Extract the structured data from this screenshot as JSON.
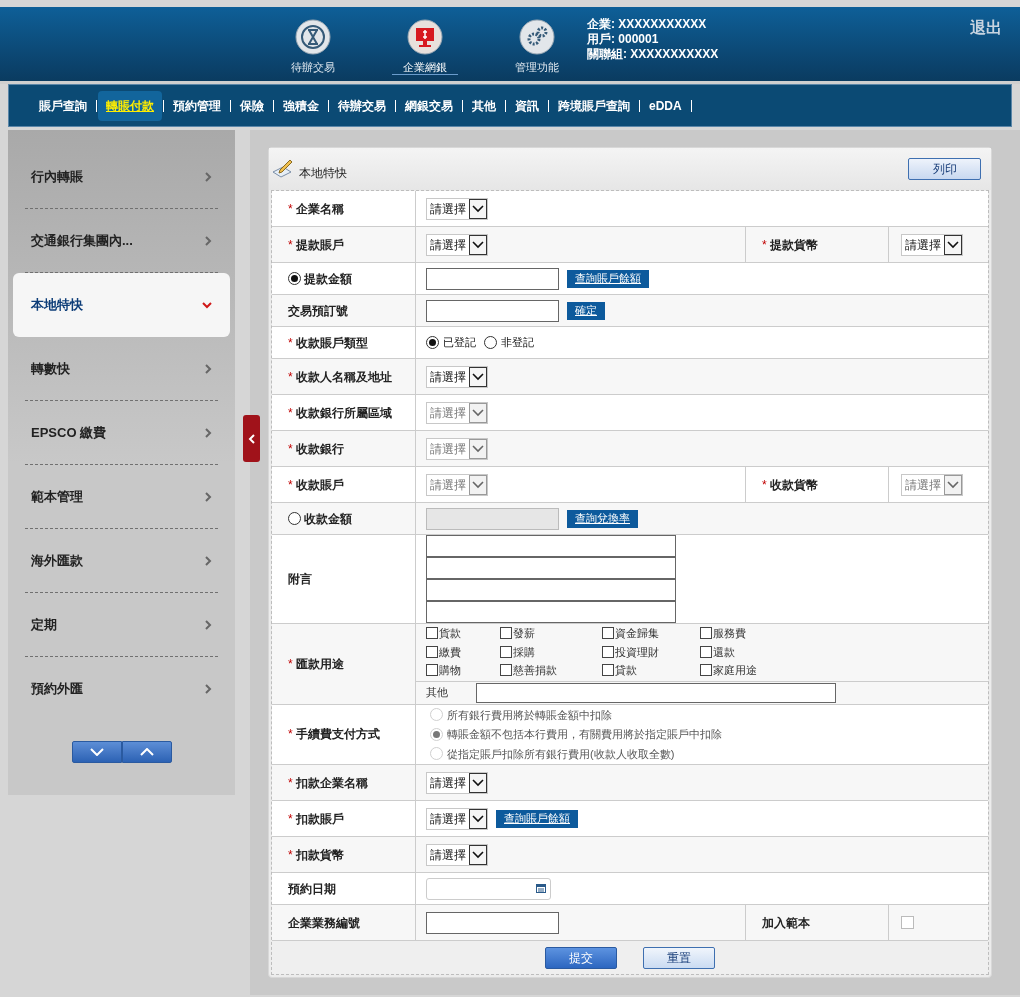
{
  "header": {
    "apps": [
      {
        "label": "待辦交易",
        "selected": false,
        "kind": "hourglass"
      },
      {
        "label": "企業網銀",
        "selected": true,
        "kind": "monitor"
      },
      {
        "label": "管理功能",
        "selected": false,
        "kind": "gears"
      }
    ],
    "user_info": [
      "企業: XXXXXXXXXXX",
      "用戶: 000001",
      "關聯組: XXXXXXXXXXX"
    ],
    "logout": "退出"
  },
  "nav": [
    {
      "label": "賬戶查詢",
      "selected": false
    },
    {
      "label": "轉賬付款",
      "selected": true
    },
    {
      "label": "預約管理",
      "selected": false
    },
    {
      "label": "保險",
      "selected": false
    },
    {
      "label": "強積金",
      "selected": false
    },
    {
      "label": "待辦交易",
      "selected": false
    },
    {
      "label": "網銀交易",
      "selected": false
    },
    {
      "label": "其他",
      "selected": false
    },
    {
      "label": "資訊",
      "selected": false
    },
    {
      "label": "跨境賬戶查詢",
      "selected": false
    },
    {
      "label": "eDDA",
      "selected": false
    }
  ],
  "sidebar": {
    "items": [
      {
        "label": "行內轉賬",
        "selected": false
      },
      {
        "label": "交通銀行集團內...",
        "selected": false
      },
      {
        "label": "本地特快",
        "selected": true
      },
      {
        "label": "轉數快",
        "selected": false
      },
      {
        "label": "EPSCO 繳費",
        "selected": false
      },
      {
        "label": "範本管理",
        "selected": false
      },
      {
        "label": "海外匯款",
        "selected": false
      },
      {
        "label": "定期",
        "selected": false
      },
      {
        "label": "預約外匯",
        "selected": false
      }
    ]
  },
  "panel": {
    "title": "本地特快",
    "print_button": "列印",
    "rows": [
      {
        "kind": "inline",
        "mark": "*",
        "label": "企業名稱",
        "cells": [
          {
            "kind": "select",
            "text": "請選擇",
            "disabled": false
          }
        ]
      },
      {
        "kind": "inline",
        "mark": "*",
        "label": "提款賬戶",
        "cells": [
          {
            "kind": "select",
            "text": "請選擇",
            "disabled": false
          }
        ],
        "side": {
          "mark": "*",
          "label": "提款貨幣",
          "cells": [
            {
              "kind": "select",
              "text": "請選擇",
              "disabled": false
            }
          ]
        }
      },
      {
        "kind": "inline",
        "radio_selected": true,
        "label": "提款金額",
        "cells": [
          {
            "kind": "input",
            "disabled": false
          },
          {
            "kind": "action",
            "label": "查詢賬戶餘額"
          }
        ]
      },
      {
        "kind": "inline",
        "label": "交易預訂號",
        "cells": [
          {
            "kind": "input",
            "disabled": false
          },
          {
            "kind": "action",
            "label": "確定"
          }
        ]
      },
      {
        "kind": "inline",
        "mark": "*",
        "label": "收款賬戶類型",
        "cells": [
          {
            "kind": "radio",
            "label": "已登記",
            "selected": true,
            "disabled": false
          },
          {
            "kind": "radio",
            "label": "非登記",
            "selected": false,
            "disabled": false
          }
        ]
      },
      {
        "kind": "inline",
        "mark": "*",
        "label": "收款人名稱及地址",
        "cells": [
          {
            "kind": "select",
            "text": "請選擇",
            "disabled": false
          }
        ]
      },
      {
        "kind": "inline",
        "mark": "*",
        "label": "收款銀行所屬區域",
        "cells": [
          {
            "kind": "select",
            "text": "請選擇",
            "disabled": true
          }
        ]
      },
      {
        "kind": "inline",
        "mark": "*",
        "label": "收款銀行",
        "cells": [
          {
            "kind": "select",
            "text": "請選擇",
            "disabled": true
          }
        ]
      },
      {
        "kind": "inline",
        "mark": "*",
        "label": "收款賬戶",
        "cells": [
          {
            "kind": "select",
            "text": "請選擇",
            "disabled": true
          }
        ],
        "side": {
          "mark": "*",
          "label": "收款貨幣",
          "cells": [
            {
              "kind": "select",
              "text": "請選擇",
              "disabled": true
            }
          ]
        }
      },
      {
        "kind": "inline",
        "radio_selected": false,
        "label": "收款金額",
        "cells": [
          {
            "kind": "input",
            "disabled": true
          },
          {
            "kind": "action",
            "label": "查詢兌換率"
          }
        ]
      },
      {
        "kind": "stacked",
        "label": "附言",
        "cells": [
          {
            "kind": "input",
            "disabled": false
          },
          {
            "kind": "input",
            "disabled": false
          },
          {
            "kind": "input",
            "disabled": false
          },
          {
            "kind": "input",
            "disabled": false
          }
        ]
      },
      {
        "kind": "stacked",
        "mark": "*",
        "label": "匯款用途",
        "cells": [
          {
            "kind": "checkgrid",
            "items": [
              {
                "label": "貨款",
                "checked": false
              },
              {
                "label": "發薪",
                "checked": false
              },
              {
                "label": "資金歸集",
                "checked": false
              },
              {
                "label": "服務費",
                "checked": false
              },
              {
                "label": "繳費",
                "checked": false
              },
              {
                "label": "採購",
                "checked": false
              },
              {
                "label": "投資理財",
                "checked": false
              },
              {
                "label": "還款",
                "checked": false
              },
              {
                "label": "購物",
                "checked": false
              },
              {
                "label": "慈善捐款",
                "checked": false
              },
              {
                "label": "貸款",
                "checked": false
              },
              {
                "label": "家庭用途",
                "checked": false
              }
            ]
          }
        ],
        "other_label": "其他"
      },
      {
        "kind": "stacked",
        "mark": "*",
        "label": "手續費支付方式",
        "cells": [
          {
            "kind": "radio",
            "label": "所有銀行費用將於轉賬金額中扣除",
            "selected": false,
            "disabled": true
          },
          {
            "kind": "radio",
            "label": "轉賬金額不包括本行費用，有關費用將於指定賬戶中扣除",
            "selected": true,
            "disabled": true
          },
          {
            "kind": "radio",
            "label": "從指定賬戶扣除所有銀行費用(收款人收取全數)",
            "selected": false,
            "disabled": true
          }
        ]
      },
      {
        "kind": "inline",
        "mark": "*",
        "label": "扣款企業名稱",
        "cells": [
          {
            "kind": "select",
            "text": "請選擇",
            "disabled": false
          }
        ]
      },
      {
        "kind": "inline",
        "mark": "*",
        "label": "扣款賬戶",
        "cells": [
          {
            "kind": "select",
            "text": "請選擇",
            "disabled": false
          },
          {
            "kind": "action",
            "label": "查詢賬戶餘額"
          }
        ]
      },
      {
        "kind": "inline",
        "mark": "*",
        "label": "扣款貨幣",
        "cells": [
          {
            "kind": "select",
            "text": "請選擇",
            "disabled": false
          }
        ]
      },
      {
        "kind": "inline",
        "label": "預約日期",
        "cells": [
          {
            "kind": "date"
          }
        ]
      },
      {
        "kind": "inline",
        "label": "企業業務編號",
        "cells": [
          {
            "kind": "input",
            "disabled": false
          }
        ],
        "side": {
          "label": "加入範本",
          "cells": [
            {
              "kind": "checkbox",
              "checked": false
            }
          ]
        }
      }
    ],
    "buttons": [
      {
        "label": "提交",
        "primary": true
      },
      {
        "label": "重置",
        "primary": false
      }
    ]
  }
}
